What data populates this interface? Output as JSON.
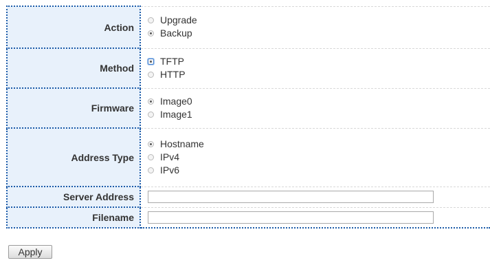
{
  "form": {
    "action": {
      "label": "Action",
      "options": [
        {
          "label": "Upgrade",
          "checked": false
        },
        {
          "label": "Backup",
          "checked": true
        }
      ]
    },
    "method": {
      "label": "Method",
      "options": [
        {
          "label": "TFTP",
          "checked": true
        },
        {
          "label": "HTTP",
          "checked": false
        }
      ]
    },
    "firmware": {
      "label": "Firmware",
      "options": [
        {
          "label": "Image0",
          "checked": true
        },
        {
          "label": "Image1",
          "checked": false
        }
      ]
    },
    "address_type": {
      "label": "Address Type",
      "options": [
        {
          "label": "Hostname",
          "checked": true
        },
        {
          "label": "IPv4",
          "checked": false
        },
        {
          "label": "IPv6",
          "checked": false
        }
      ]
    },
    "server_address": {
      "label": "Server Address",
      "value": ""
    },
    "filename": {
      "label": "Filename",
      "value": ""
    }
  },
  "apply_label": "Apply"
}
